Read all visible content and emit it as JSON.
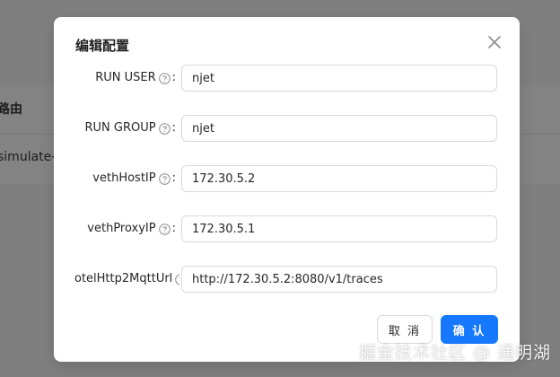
{
  "background": {
    "column_header": "路由",
    "row_cell": "simulate-"
  },
  "modal": {
    "title": "编辑配置",
    "fields": [
      {
        "label": "RUN USER",
        "value": "njet"
      },
      {
        "label": "RUN GROUP",
        "value": "njet"
      },
      {
        "label": "vethHostIP",
        "value": "172.30.5.2"
      },
      {
        "label": "vethProxyIP",
        "value": "172.30.5.1"
      },
      {
        "label": "otelHttp2MqttUrl",
        "value": "http://172.30.5.2:8080/v1/traces"
      }
    ],
    "colon": ":",
    "cancel_label": "取 消",
    "ok_label": "确 认"
  },
  "watermark": "掘金技术社区 @ 通明湖",
  "colors": {
    "primary": "#1677ff",
    "border": "#d9d9d9",
    "overlay": "#7f7f7f"
  },
  "icons": {
    "close": "close-icon",
    "help": "question-circle-icon"
  }
}
